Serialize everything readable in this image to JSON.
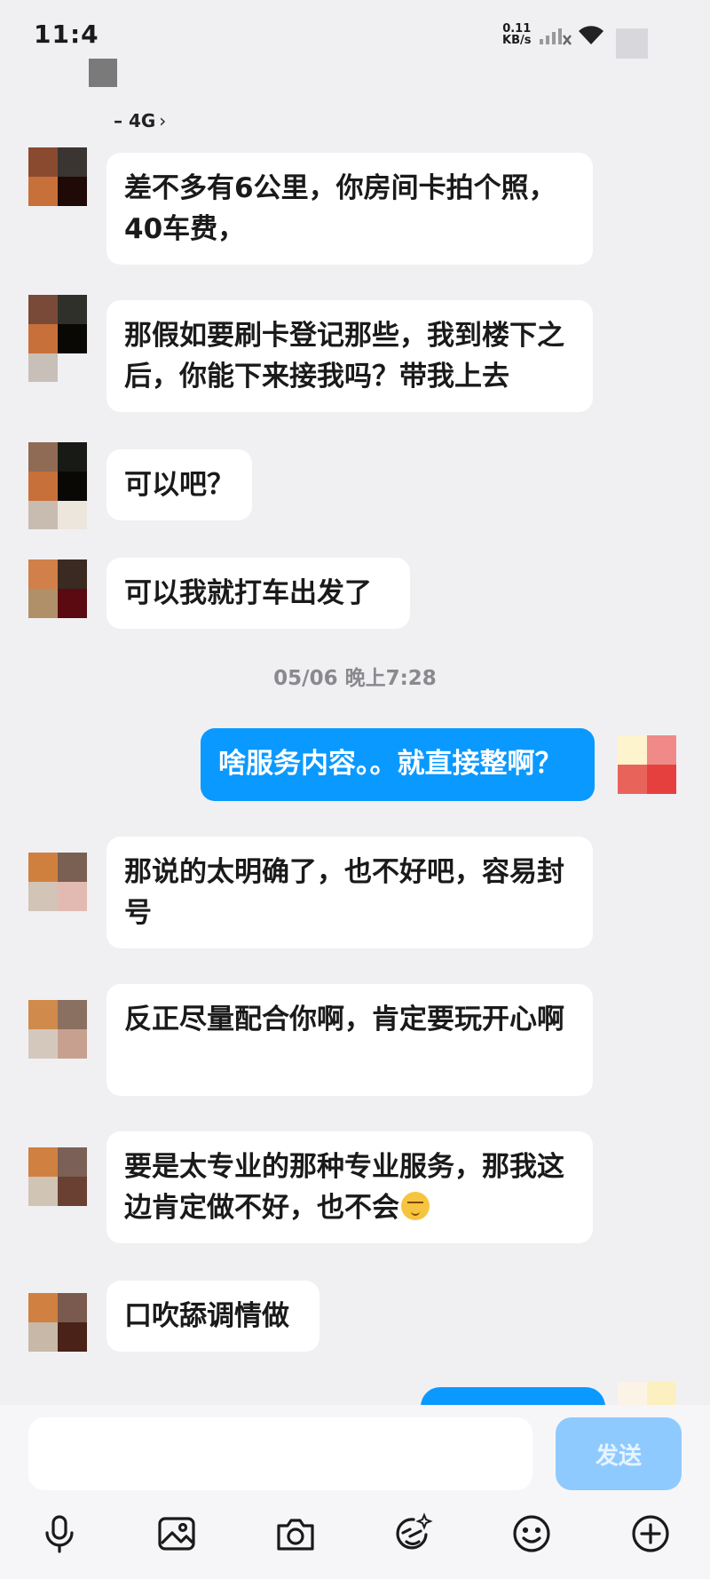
{
  "status_bar": {
    "time": "11:4",
    "net_speed_value": "0.11",
    "net_speed_unit": "KB/s",
    "signal_icon": "signal-icon",
    "wifi_icon": "wifi-icon"
  },
  "header": {
    "subtitle": "– 4G",
    "chevron": "›"
  },
  "messages": [
    {
      "side": "received",
      "text": "差不多有6公里，你房间卡拍个照，40车费，"
    },
    {
      "side": "received",
      "text": "那假如要刷卡登记那些，我到楼下之后，你能下来接我吗？带我上去"
    },
    {
      "side": "received",
      "text": "可以吧？"
    },
    {
      "side": "received",
      "text": "可以我就打车出发了"
    },
    {
      "side": "sent",
      "text": "啥服务内容。。就直接整啊？"
    },
    {
      "side": "received",
      "text": "那说的太明确了，也不好吧，容易封号"
    },
    {
      "side": "received",
      "text": "反正尽量配合你啊，肯定要玩开心啊"
    },
    {
      "side": "received",
      "text": "要是太专业的那种专业服务，那我这边肯定做不好，也不会"
    },
    {
      "side": "received",
      "text": "口吹舔调情做"
    }
  ],
  "timestamp": "05/06 晚上7:28",
  "input": {
    "send_label": "发送"
  },
  "toolbar": [
    "microphone-icon",
    "image-icon",
    "camera-icon",
    "sticker-icon",
    "emoji-icon",
    "plus-icon"
  ],
  "colors": {
    "background": "#f0f0f3",
    "sent_bubble": "#0a99ff",
    "send_button_disabled": "#8fcaff"
  }
}
